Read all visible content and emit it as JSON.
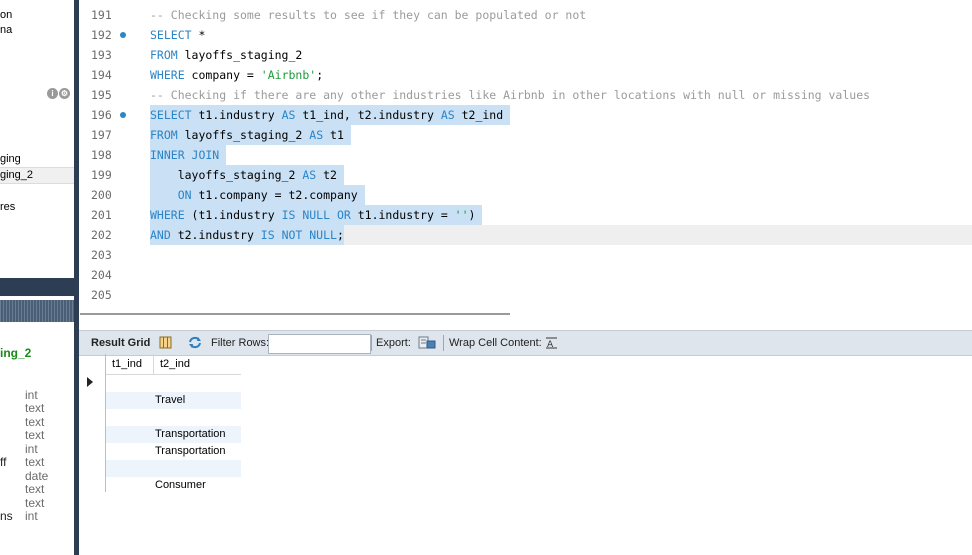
{
  "navigator": {
    "items": [
      "on",
      "na",
      "ging",
      "ging_2",
      "res"
    ],
    "info_title": "ing_2",
    "columns": [
      {
        "name": "",
        "type": "int"
      },
      {
        "name": "",
        "type": "text"
      },
      {
        "name": "",
        "type": "text"
      },
      {
        "name": "",
        "type": "text"
      },
      {
        "name": "",
        "type": "int"
      },
      {
        "name": "ff",
        "type": "text"
      },
      {
        "name": "",
        "type": "date"
      },
      {
        "name": "",
        "type": "text"
      },
      {
        "name": "",
        "type": "text"
      },
      {
        "name": "ns",
        "type": "int"
      }
    ],
    "icon_info": "i",
    "icon_tool": "⚙"
  },
  "editor": {
    "lines": [
      {
        "num": "191",
        "text": "-- Checking some results to see if they can be populated or not"
      },
      {
        "num": "192",
        "text": "SELECT *"
      },
      {
        "num": "193",
        "text": "FROM layoffs_staging_2"
      },
      {
        "num": "194",
        "text": "WHERE company = 'Airbnb';"
      },
      {
        "num": "195",
        "text": "-- Checking if there are any other industries like Airbnb in other locations with null or missing values"
      },
      {
        "num": "196",
        "text": "SELECT t1.industry AS t1_ind, t2.industry AS t2_ind"
      },
      {
        "num": "197",
        "text": "FROM layoffs_staging_2 AS t1"
      },
      {
        "num": "198",
        "text": "INNER JOIN"
      },
      {
        "num": "199",
        "text": "    layoffs_staging_2 AS t2"
      },
      {
        "num": "200",
        "text": "    ON t1.company = t2.company"
      },
      {
        "num": "201",
        "text": "WHERE (t1.industry IS NULL OR t1.industry = '')"
      },
      {
        "num": "202",
        "text": "AND t2.industry IS NOT NULL;"
      },
      {
        "num": "203",
        "text": ""
      },
      {
        "num": "204",
        "text": ""
      },
      {
        "num": "205",
        "text": ""
      }
    ]
  },
  "toolbar": {
    "result_grid": "Result Grid",
    "filter_rows": "Filter Rows:",
    "filter_value": "",
    "export": "Export:",
    "wrap": "Wrap Cell Content:"
  },
  "grid": {
    "columns": [
      "t1_ind",
      "t2_ind"
    ],
    "rows": [
      [
        "",
        ""
      ],
      [
        "",
        "Travel"
      ],
      [
        "",
        ""
      ],
      [
        "",
        "Transportation"
      ],
      [
        "",
        "Transportation"
      ],
      [
        "",
        ""
      ],
      [
        "",
        "Consumer"
      ]
    ]
  }
}
